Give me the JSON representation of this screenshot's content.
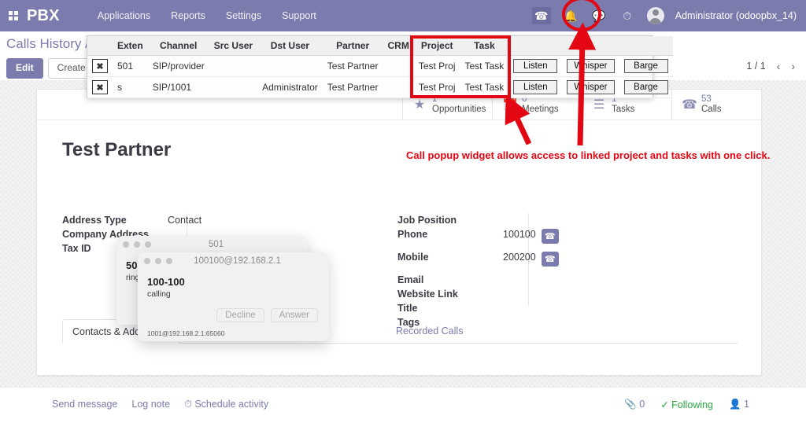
{
  "navbar": {
    "apps_icon": "apps-grid-icon",
    "brand": "PBX",
    "menu": [
      "Applications",
      "Reports",
      "Settings",
      "Support"
    ],
    "icons": [
      "phone-icon",
      "activity-icon",
      "messages-icon",
      "clock-icon"
    ],
    "user": "Administrator (odoopbx_14)"
  },
  "control_panel": {
    "breadcrumb": "Calls History /",
    "edit_label": "Edit",
    "create_label": "Create",
    "pager_text": "1 / 1",
    "prev_icon": "chevron-left-icon",
    "next_icon": "chevron-right-icon"
  },
  "calls_popup": {
    "columns": [
      "",
      "Exten",
      "Channel",
      "Src User",
      "Dst User",
      "Partner",
      "CRM",
      "Project",
      "Task",
      "",
      "",
      ""
    ],
    "rows": [
      {
        "close": "✖",
        "exten": "501",
        "channel": "SIP/provider",
        "src_user": "",
        "dst_user": "",
        "partner": "Test Partner",
        "crm": "",
        "project": "Test Proj",
        "task": "Test Task",
        "listen": "Listen",
        "whisper": "Whisper",
        "barge": "Barge"
      },
      {
        "close": "✖",
        "exten": "s",
        "channel": "SIP/1001",
        "src_user": "",
        "dst_user": "Administrator",
        "partner": "Test Partner",
        "crm": "",
        "project": "Test Proj",
        "task": "Test Task",
        "listen": "Listen",
        "whisper": "Whisper",
        "barge": "Barge"
      }
    ]
  },
  "annotation": {
    "text": "Call popup widget allows access to linked project and tasks with one click.",
    "color": "#e30613"
  },
  "stat_buttons": [
    {
      "icon": "star-icon",
      "value": "1",
      "label": "Opportunities"
    },
    {
      "icon": "calendar-icon",
      "value": "0",
      "label": "Meetings"
    },
    {
      "icon": "list-icon",
      "value": "1",
      "label": "Tasks"
    },
    {
      "icon": "phone-icon",
      "value": "53",
      "label": "Calls"
    }
  ],
  "record": {
    "title": "Test Partner",
    "left_fields": [
      {
        "label": "Address Type",
        "value": "Contact"
      },
      {
        "label": "Company Address",
        "value": ""
      },
      {
        "label": "Tax ID",
        "value": ""
      }
    ],
    "right_fields": [
      {
        "label": "Job Position",
        "value": ""
      },
      {
        "label": "Phone",
        "value": "100100",
        "call": true
      },
      {
        "label": "Mobile",
        "value": "200200",
        "call": true
      },
      {
        "label": "Email",
        "value": ""
      },
      {
        "label": "Website Link",
        "value": ""
      },
      {
        "label": "Title",
        "value": ""
      },
      {
        "label": "Tags",
        "value": ""
      }
    ]
  },
  "tabs": [
    {
      "label": "Contacts & Addresses",
      "active": true
    },
    {
      "label": "Recorded Calls",
      "active": false
    }
  ],
  "softphones": [
    {
      "title": "501",
      "number": "501",
      "state": "ringing",
      "decline": "decline",
      "answer": "",
      "footer": ""
    },
    {
      "title": "100100@192.168.2.1",
      "number": "100-100",
      "state": "calling",
      "decline": "Decline",
      "answer": "Answer",
      "footer": "1001@192.168.2.1:65060"
    }
  ],
  "footer": {
    "send_message": "Send message",
    "log_note": "Log note",
    "schedule_activity": "Schedule activity",
    "attachments_count": "0",
    "following": "Following",
    "followers_count": "1"
  },
  "colors": {
    "navbar": "#7c7bad",
    "accent": "#7c7bad",
    "annotation_red": "#e30613",
    "following_green": "#28a745"
  }
}
